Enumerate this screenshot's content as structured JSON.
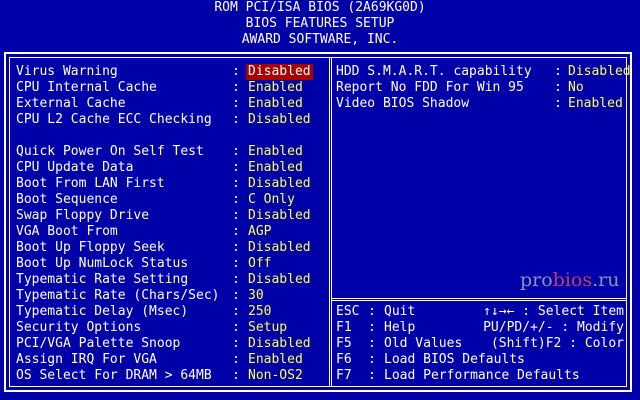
{
  "header": {
    "line1": "ROM PCI/ISA BIOS (2A69KG0D)",
    "line2": "BIOS FEATURES SETUP",
    "line3": "AWARD SOFTWARE, INC."
  },
  "left_items": [
    {
      "label": "Virus Warning",
      "value": "Disabled",
      "selected": true
    },
    {
      "label": "CPU Internal Cache",
      "value": "Enabled"
    },
    {
      "label": "External Cache",
      "value": "Enabled"
    },
    {
      "label": "CPU L2 Cache ECC Checking",
      "value": "Disabled"
    },
    {
      "label": "Quick Power On Self Test",
      "value": "Enabled"
    },
    {
      "label": "CPU Update Data",
      "value": "Enabled"
    },
    {
      "label": "Boot From LAN First",
      "value": "Disabled"
    },
    {
      "label": "Boot Sequence",
      "value": "C Only"
    },
    {
      "label": "Swap Floppy Drive",
      "value": "Disabled"
    },
    {
      "label": "VGA Boot From",
      "value": "AGP"
    },
    {
      "label": "Boot Up Floppy Seek",
      "value": "Disabled"
    },
    {
      "label": "Boot Up NumLock Status",
      "value": "Off"
    },
    {
      "label": "Typematic Rate Setting",
      "value": "Disabled"
    },
    {
      "label": "Typematic Rate (Chars/Sec)",
      "value": "30"
    },
    {
      "label": "Typematic Delay (Msec)",
      "value": "250"
    },
    {
      "label": "Security Options",
      "value": "Setup"
    },
    {
      "label": "PCI/VGA Palette Snoop",
      "value": "Disabled"
    },
    {
      "label": "Assign IRQ For VGA",
      "value": "Enabled"
    },
    {
      "label": "OS Select For DRAM > 64MB",
      "value": "Non-OS2"
    }
  ],
  "right_items": [
    {
      "label": "HDD S.M.A.R.T. capability",
      "value": "Disabled"
    },
    {
      "label": "Report No FDD For Win 95",
      "value": "No"
    },
    {
      "label": "Video BIOS Shadow",
      "value": "Enabled"
    }
  ],
  "help": [
    {
      "key": "ESC",
      "action": "Quit",
      "right": "↑↓→← : Select Item"
    },
    {
      "key": "F1",
      "action": "Help",
      "right": "PU/PD/+/- : Modify"
    },
    {
      "key": "F5",
      "action": "Old Values",
      "right": "(Shift)F2 : Color"
    },
    {
      "key": "F6",
      "action": "Load BIOS Defaults",
      "right": ""
    },
    {
      "key": "F7",
      "action": "Load Performance Defaults",
      "right": ""
    }
  ],
  "watermark": {
    "part1": "pro",
    "part2": "bios",
    "part3": ".ru"
  },
  "colors": {
    "background": "#0000a8",
    "value": "#ffff54",
    "selected_bg": "#a80000",
    "text": "#ffffff"
  }
}
